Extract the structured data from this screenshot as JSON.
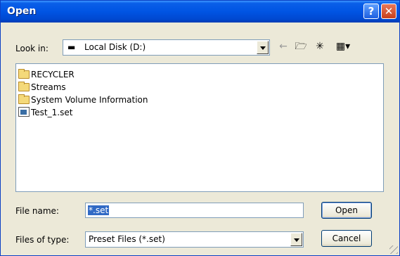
{
  "window": {
    "title": "Open",
    "help_button": "?",
    "close_button": "✕"
  },
  "toolbar": {
    "look_in_label": "Look in:",
    "look_in_accel": "i",
    "look_in_value": "Local Disk (D:)",
    "icons": [
      "back-arrow-icon",
      "up-folder-icon",
      "new-folder-icon",
      "view-menu-icon"
    ]
  },
  "files": [
    {
      "name": "RECYCLER",
      "icon": "folder-icon"
    },
    {
      "name": "Streams",
      "icon": "folder-icon"
    },
    {
      "name": "System Volume Information",
      "icon": "folder-icon"
    },
    {
      "name": "Test_1.set",
      "icon": "set-file-icon"
    }
  ],
  "form": {
    "file_name_label": "File name:",
    "file_name_value": "*.set",
    "files_of_type_label": "Files of type:",
    "files_of_type_value": "Preset Files (*.set)"
  },
  "buttons": {
    "open": "Open",
    "cancel": "Cancel"
  }
}
